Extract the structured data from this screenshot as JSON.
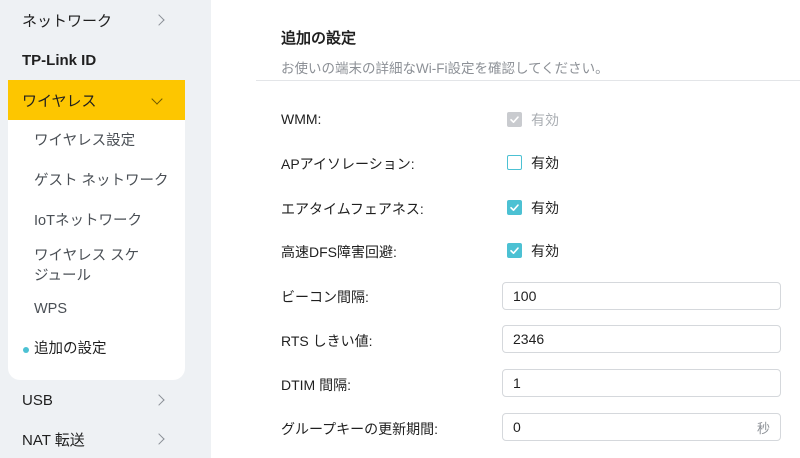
{
  "sidebar": {
    "network": "ネットワーク",
    "tplink_id": "TP-Link ID",
    "wireless": "ワイヤレス",
    "sub_items": {
      "wireless_settings": "ワイヤレス設定",
      "guest_network": "ゲスト ネットワーク",
      "iot_network": "IoTネットワーク",
      "wireless_schedule_line1": "ワイヤレス スケ",
      "wireless_schedule_line2": "ジュール",
      "wps": "WPS",
      "advanced": "追加の設定"
    },
    "usb": "USB",
    "nat": "NAT 転送"
  },
  "main": {
    "title": "追加の設定",
    "subtitle": "お使いの端末の詳細なWi-Fi設定を確認してください。",
    "rows": {
      "wmm": {
        "label": "WMM:",
        "option": "有効",
        "checked": true,
        "disabled": true
      },
      "ap_isolation": {
        "label": "APアイソレーション:",
        "option": "有効",
        "checked": false
      },
      "airtime_fairness": {
        "label": "エアタイムフェアネス:",
        "option": "有効",
        "checked": true
      },
      "dfs": {
        "label": "高速DFS障害回避:",
        "option": "有効",
        "checked": true
      },
      "beacon": {
        "label": "ビーコン間隔:",
        "value": "100"
      },
      "rts": {
        "label": "RTS しきい値:",
        "value": "2346"
      },
      "dtim": {
        "label": "DTIM 間隔:",
        "value": "1"
      },
      "group_key": {
        "label": "グループキーの更新期間:",
        "value": "0",
        "unit": "秒"
      }
    }
  },
  "colors": {
    "accent": "#4cc1d3",
    "highlight": "#fdc600"
  }
}
